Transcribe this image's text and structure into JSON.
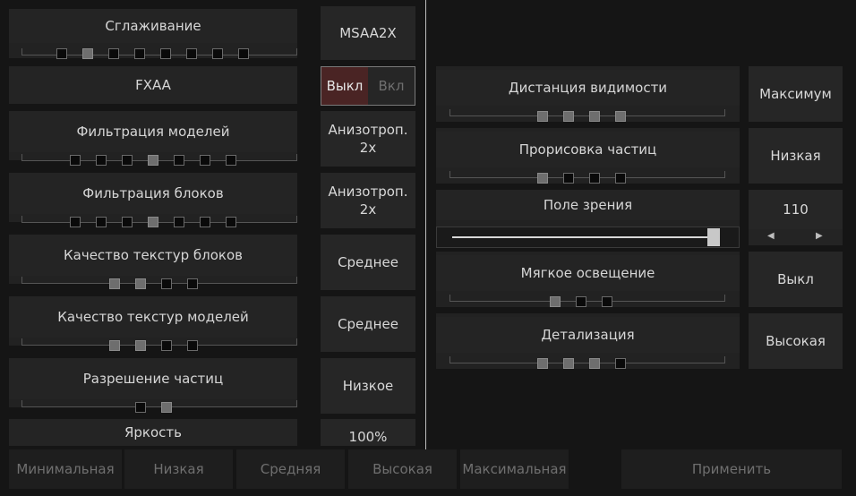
{
  "left_settings": [
    {
      "label": "Сглаживание",
      "value": "MSAA2X",
      "steps": 8,
      "active": [
        1
      ]
    },
    {
      "label": "FXAA",
      "toggle": {
        "off": "Выкл",
        "on": "Вкл",
        "selected": "off"
      }
    },
    {
      "label": "Фильтрация моделей",
      "value_lines": [
        "Анизотроп.",
        "2x"
      ],
      "steps": 7,
      "active": [
        3
      ]
    },
    {
      "label": "Фильтрация блоков",
      "value_lines": [
        "Анизотроп.",
        "2x"
      ],
      "steps": 7,
      "active": [
        3
      ]
    },
    {
      "label": "Качество текстур блоков",
      "value": "Среднее",
      "steps": 4,
      "active": [
        0,
        1
      ]
    },
    {
      "label": "Качество текстур моделей",
      "value": "Среднее",
      "steps": 4,
      "active": [
        0,
        1
      ]
    },
    {
      "label": "Разрешение частиц",
      "value": "Низкое",
      "steps": 2,
      "active": [
        1
      ]
    },
    {
      "label": "Яркость",
      "value": "100%"
    }
  ],
  "right_settings": [
    {
      "label": "Дистанция видимости",
      "value": "Максимум",
      "steps": 4,
      "active": [
        0,
        1,
        2,
        3
      ]
    },
    {
      "label": "Прорисовка частиц",
      "value": "Низкая",
      "steps": 4,
      "active": [
        0
      ]
    },
    {
      "label": "Поле зрения",
      "value": "110",
      "slider_fraction": 1.0
    },
    {
      "label": "Мягкое освещение",
      "value": "Выкл",
      "steps": 3,
      "active": [
        0
      ]
    },
    {
      "label": "Детализация",
      "value": "Высокая",
      "steps": 4,
      "active": [
        0,
        1,
        2
      ]
    }
  ],
  "presets": [
    "Минимальная",
    "Низкая",
    "Средняя",
    "Высокая",
    "Максимальная"
  ],
  "apply_label": "Применить",
  "colors": {
    "toggle_off_bg": "#4a2424",
    "accent_off_text": "#e6e6e6",
    "disabled_text": "#6f6f6f"
  },
  "icons": {
    "fov_decrease": "left-arrow-icon",
    "fov_increase": "right-arrow-icon"
  }
}
